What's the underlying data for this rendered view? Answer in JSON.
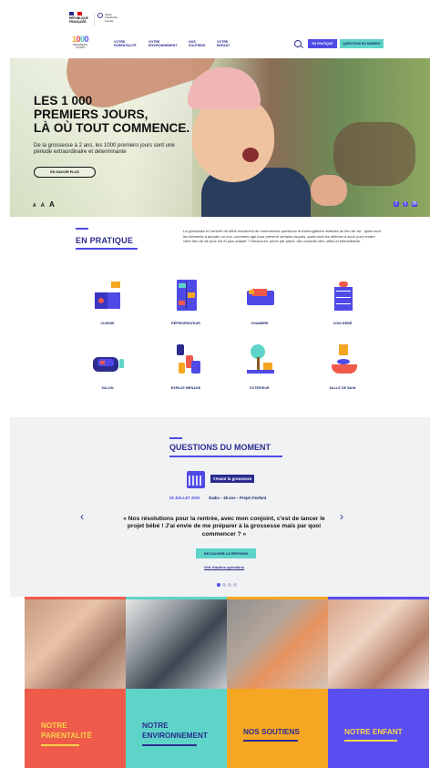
{
  "gov": {
    "republic_text": "RÉPUBLIQUE\nFRANÇAISE",
    "ministry_text": "Santé\nSolidarités\nFamille"
  },
  "logo": {
    "number": [
      "1",
      "0",
      "0",
      "0"
    ],
    "subtitle": "PREMIERS\nJOURS"
  },
  "nav": {
    "items": [
      "VOTRE\nPARENTALITÉ",
      "VOTRE\nENVIRONNEMENT",
      "NOS\nSOUTIENS",
      "VOTRE\nENFANT"
    ],
    "pro_button": "ES PRATIQUE",
    "question_button": "QUESTIONS DU MOMENT"
  },
  "hero": {
    "title": "LES 1 000\nPREMIERS JOURS,\nLÀ OÙ TOUT COMMENCE.",
    "subtitle": "De la grossesse à 2 ans, les 1000 premiers jours sont une période extraordinaire et déterminante",
    "cta": "EN SAVOIR PLUS",
    "font_controls": [
      "A",
      "A",
      "A"
    ],
    "social_icons": [
      "facebook-icon",
      "twitter-icon",
      "mail-icon"
    ]
  },
  "en_pratique": {
    "title": "EN PRATIQUE",
    "text": "La grossesse et l'arrivée de bébé entraînent de nombreuses questions et interrogations relatives au lieu de vie : quels sont les éléments à adopter ou non, comment agir pour prévenir certains risques, quels sont les réflexes à avoir pour rendre votre lieu de vie plus sûr et plus adapté ? Découvrez, pièce par pièce, des conseils clés, utiles et bienveillants."
  },
  "rooms": [
    {
      "label": "CUISINE",
      "icon": "kitchen-icon"
    },
    {
      "label": "RÉFRIGÉRATEUR",
      "icon": "fridge-icon"
    },
    {
      "label": "CHAMBRE",
      "icon": "bed-icon"
    },
    {
      "label": "COIN BÉBÉ",
      "icon": "dresser-icon"
    },
    {
      "label": "SALON",
      "icon": "sofa-icon"
    },
    {
      "label": "ESPACE MÉNAGE",
      "icon": "cleaning-icon"
    },
    {
      "label": "EXTÉRIEUR",
      "icon": "tree-icon"
    },
    {
      "label": "SALLE DE BAIN",
      "icon": "bath-icon"
    }
  ],
  "questions": {
    "title": "QUESTIONS DU MOMENT",
    "tag": "#Avant la grossesse",
    "date": "29 JUILLET 2020",
    "author": "Nadia – 26 ans – Projet d'enfant",
    "quote": "« Nos résolutions pour la rentrée, avec mon conjoint, c'est de lancer le projet bébé ! J'ai envie de me préparer à la grossesse mais par quoi commencer ? »",
    "answer_button": "DÉCOUVRIR LA RÉPONSE",
    "more_link": "Voir d'autres questions",
    "prev": "‹",
    "next": "›"
  },
  "tiles": [
    {
      "label": "NOTRE\nPARENTALITÉ",
      "panel_color": "#ef5a4a",
      "text_color": "#f7d44c"
    },
    {
      "label": "NOTRE\nENVIRONNEMENT",
      "panel_color": "#5ed4c8",
      "text_color": "#2b2b8f"
    },
    {
      "label": "NOS SOUTIENS",
      "panel_color": "#f5a623",
      "text_color": "#2b2b8f"
    },
    {
      "label": "NOTRE ENFANT",
      "panel_color": "#5a4ef0",
      "text_color": "#f7d44c"
    }
  ],
  "colors": {
    "primary": "#4f4ae6",
    "navy": "#2b2b8f",
    "teal": "#5ed4c8",
    "red": "#ef5a4a",
    "orange": "#f5a623"
  }
}
